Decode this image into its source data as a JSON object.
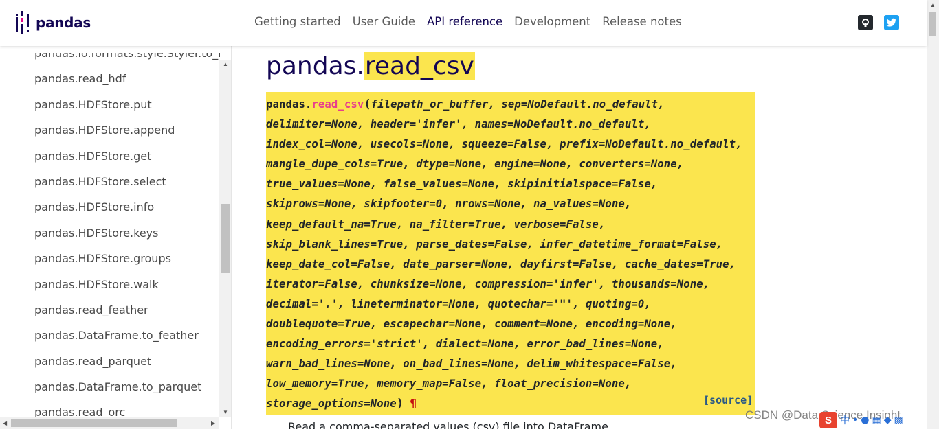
{
  "navbar": {
    "brand": "pandas",
    "links": [
      "Getting started",
      "User Guide",
      "API reference",
      "Development",
      "Release notes"
    ],
    "active_index": 2,
    "icons": [
      "github-icon",
      "twitter-icon"
    ]
  },
  "sidebar": {
    "items": [
      "pandas.io.formats.style.Styler.to_latex",
      "pandas.read_hdf",
      "pandas.HDFStore.put",
      "pandas.HDFStore.append",
      "pandas.HDFStore.get",
      "pandas.HDFStore.select",
      "pandas.HDFStore.info",
      "pandas.HDFStore.keys",
      "pandas.HDFStore.groups",
      "pandas.HDFStore.walk",
      "pandas.read_feather",
      "pandas.DataFrame.to_feather",
      "pandas.read_parquet",
      "pandas.DataFrame.to_parquet",
      "pandas.read_orc"
    ]
  },
  "main": {
    "title_prefix": "pandas.",
    "title_name": "read_csv",
    "signature": {
      "module": "pandas.",
      "name": "read_csv",
      "open": "(",
      "lines": [
        "filepath_or_buffer, sep=NoDefault.no_default,",
        "delimiter=None, header='infer', names=NoDefault.no_default,",
        "index_col=None, usecols=None, squeeze=False, prefix=NoDefault.no_default,",
        "mangle_dupe_cols=True, dtype=None, engine=None, converters=None,",
        "true_values=None, false_values=None, skipinitialspace=False,",
        "skiprows=None, skipfooter=0, nrows=None, na_values=None,",
        "keep_default_na=True, na_filter=True, verbose=False,",
        "skip_blank_lines=True, parse_dates=False, infer_datetime_format=False,",
        "keep_date_col=False, date_parser=None, dayfirst=False, cache_dates=True,",
        "iterator=False, chunksize=None, compression='infer', thousands=None,",
        "decimal='.', lineterminator=None, quotechar='\"', quoting=0,",
        "doublequote=True, escapechar=None, comment=None, encoding=None,",
        "encoding_errors='strict', dialect=None, error_bad_lines=None,",
        "warn_bad_lines=None, on_bad_lines=None, delim_whitespace=False,",
        "low_memory=True, memory_map=False, float_precision=None,",
        "storage_options=None"
      ],
      "close": ")",
      "permalink": "¶",
      "source_label": "[source]"
    },
    "description": "Read a comma-separated values (csv) file into DataFrame."
  },
  "watermark": {
    "text": "CSDN @Data Science Insight",
    "tray_logo": "S",
    "tray_lang": "中"
  },
  "colors": {
    "brand": "#130654",
    "highlight": "#fbe54e",
    "function_name": "#e83e8c",
    "source_link": "#2b5a85"
  }
}
